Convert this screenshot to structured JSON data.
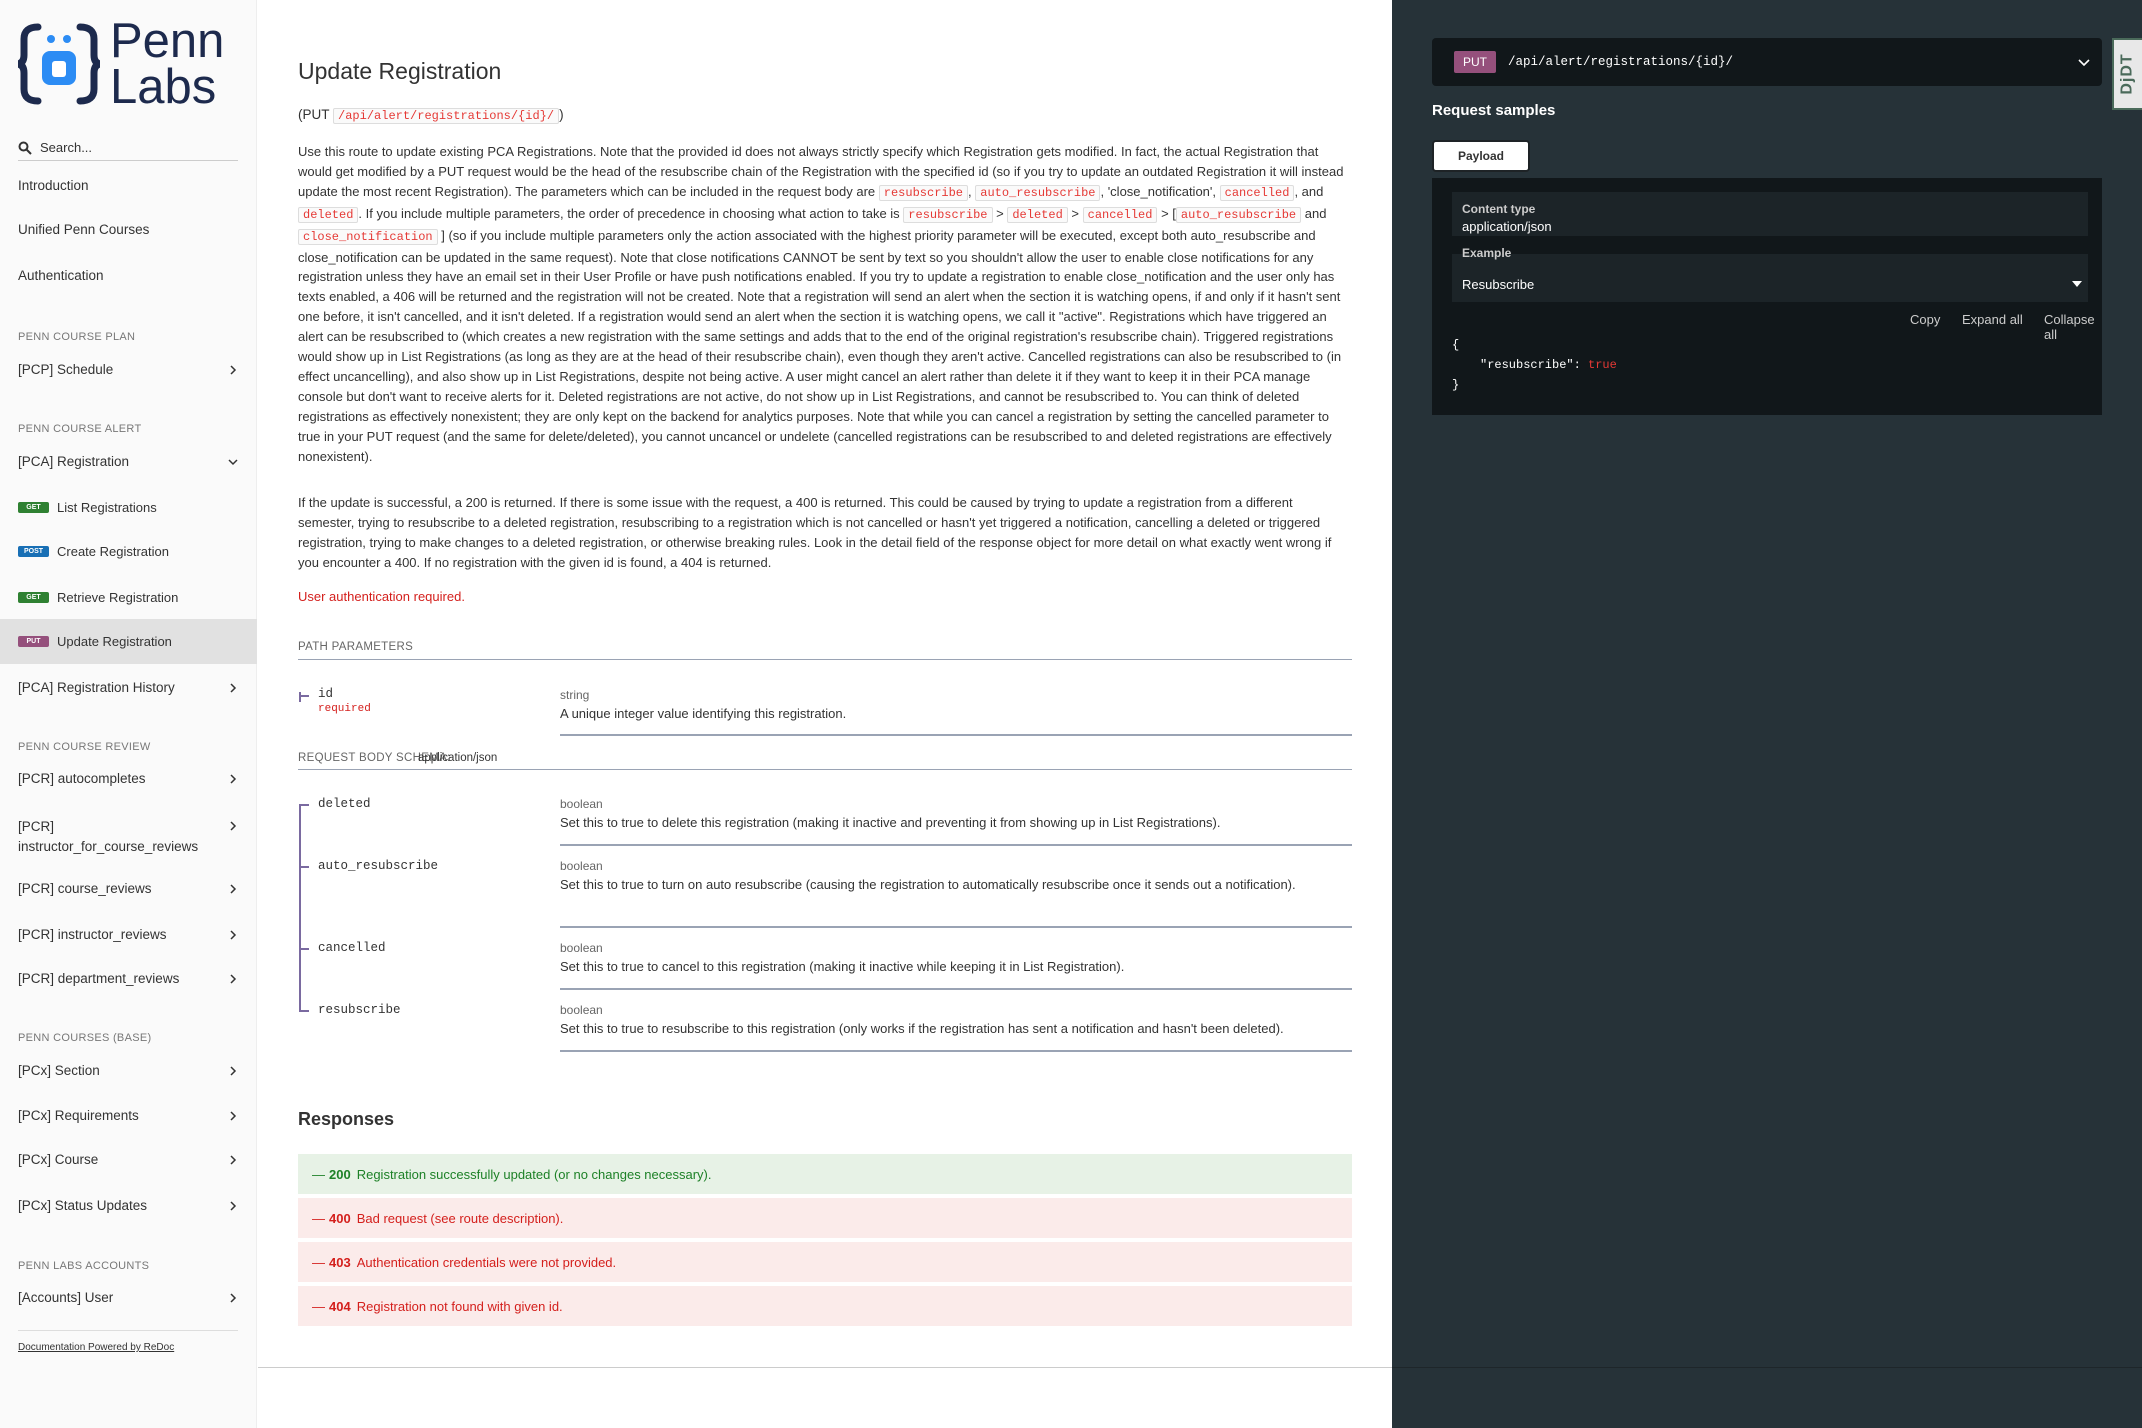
{
  "sidebar": {
    "logo_text_line1": "Penn",
    "logo_text_line2": "Labs",
    "search_placeholder": "Search...",
    "top_items": [
      "Introduction",
      "Unified Penn Courses",
      "Authentication"
    ],
    "sections": {
      "pcp": "PENN COURSE PLAN",
      "pca": "PENN COURSE ALERT",
      "pcr": "PENN COURSE REVIEW",
      "pcx": "PENN COURSES (BASE)",
      "accounts": "PENN LABS ACCOUNTS"
    },
    "pcp_items": [
      "[PCP] Schedule"
    ],
    "pca_group": "[PCA] Registration",
    "pca_subitems": [
      {
        "method": "GET",
        "label": "List Registrations"
      },
      {
        "method": "POST",
        "label": "Create Registration"
      },
      {
        "method": "GET",
        "label": "Retrieve Registration"
      },
      {
        "method": "PUT",
        "label": "Update Registration"
      }
    ],
    "pca_history": "[PCA] Registration History",
    "pcr_items": [
      "[PCR] autocompletes",
      "[PCR]",
      "instructor_for_course_reviews",
      "[PCR] course_reviews",
      "[PCR] instructor_reviews",
      "[PCR] department_reviews"
    ],
    "pcx_items": [
      "[PCx] Section",
      "[PCx] Requirements",
      "[PCx] Course",
      "[PCx] Status Updates"
    ],
    "accounts_items": [
      "[Accounts] User"
    ],
    "powered_by": "Documentation Powered by ReDoc"
  },
  "main": {
    "title": "Update Registration",
    "route_method": "PUT",
    "route_path": "/api/alert/registrations/{id}/",
    "desc_p1": {
      "a": "Use this route to update existing PCA Registrations. Note that the provided id does not always strictly specify which Registration gets modified. In fact, the actual Registration that would get modified by a PUT request would be the head of the resubscribe chain of the Registration with the specified id (so if you try to update an outdated Registration it will instead update the most recent Registration). The parameters which can be included in the request body are",
      "t1": "resubscribe",
      "b": ",",
      "t2": "auto_resubscribe",
      "c": ", 'close_notification',",
      "t3": "cancelled",
      "d": ", and",
      "t4": "deleted",
      "e": ". If you include multiple parameters, the order of precedence in choosing what action to take is",
      "t5": "resubscribe",
      "f": ">",
      "t6": "deleted",
      "g": ">",
      "t7": "cancelled",
      "h": "> [",
      "t8": "auto_resubscribe",
      "i": "and",
      "t9": "close_notification",
      "j": "] (so if you include multiple parameters only the action associated with the highest priority parameter will be executed, except both auto_resubscribe and close_notification can be updated in the same request). Note that close notifications CANNOT be sent by text so you shouldn't allow the user to enable close notifications for any registration unless they have an email set in their User Profile or have push notifications enabled. If you try to update a registration to enable close_notification and the user only has texts enabled, a 406 will be returned and the registration will not be created. Note that a registration will send an alert when the section it is watching opens, if and only if it hasn't sent one before, it isn't cancelled, and it isn't deleted. If a registration would send an alert when the section it is watching opens, we call it \"active\". Registrations which have triggered an alert can be resubscribed to (which creates a new registration with the same settings and adds that to the end of the original registration's resubscribe chain). Triggered registrations would show up in List Registrations (as long as they are at the head of their resubscribe chain), even though they aren't active. Cancelled registrations can also be resubscribed to (in effect uncancelling), and also show up in List Registrations, despite not being active. A user might cancel an alert rather than delete it if they want to keep it in their PCA manage console but don't want to receive alerts for it. Deleted registrations are not active, do not show up in List Registrations, and cannot be resubscribed to. You can think of deleted registrations as effectively nonexistent; they are only kept on the backend for analytics purposes. Note that while you can cancel a registration by setting the cancelled parameter to true in your PUT request (and the same for delete/deleted), you cannot uncancel or undelete (cancelled registrations can be resubscribed to and deleted registrations are effectively nonexistent)."
    },
    "desc_p2": "If the update is successful, a 200 is returned. If there is some issue with the request, a 400 is returned. This could be caused by trying to update a registration from a different semester, trying to resubscribe to a deleted registration, resubscribing to a registration which is not cancelled or hasn't yet triggered a notification, cancelling a deleted or triggered registration, trying to make changes to a deleted registration, or otherwise breaking rules. Look in the detail field of the response object for more detail on what exactly went wrong if you encounter a 400. If no registration with the given id is found, a 404 is returned.",
    "auth_required": "User authentication required.",
    "path_params_label": "PATH PARAMETERS",
    "path_param": {
      "name": "id",
      "required": "required",
      "type": "string",
      "desc": "A unique integer value identifying this registration."
    },
    "body_schema_label": "REQUEST BODY SCHEMA:",
    "body_schema_type": "application/json",
    "body_params": [
      {
        "name": "deleted",
        "type": "boolean",
        "desc": "Set this to true to delete this registration (making it inactive and preventing it from showing up in List Registrations)."
      },
      {
        "name": "auto_resubscribe",
        "type": "boolean",
        "desc": "Set this to true to turn on auto resubscribe (causing the registration to automatically resubscribe once it sends out a notification)."
      },
      {
        "name": "cancelled",
        "type": "boolean",
        "desc": "Set this to true to cancel to this registration (making it inactive while keeping it in List Registration)."
      },
      {
        "name": "resubscribe",
        "type": "boolean",
        "desc": "Set this to true to resubscribe to this registration (only works if the registration has sent a notification and hasn't been deleted)."
      }
    ],
    "responses_title": "Responses",
    "responses": [
      {
        "code": "200",
        "desc": "Registration successfully updated (or no changes necessary)."
      },
      {
        "code": "400",
        "desc": "Bad request (see route description)."
      },
      {
        "code": "403",
        "desc": "Authentication credentials were not provided."
      },
      {
        "code": "404",
        "desc": "Registration not found with given id."
      }
    ],
    "dash": "—"
  },
  "right": {
    "method": "PUT",
    "path": "/api/alert/registrations/{id}/",
    "samples_title": "Request samples",
    "tab_payload": "Payload",
    "content_type_label": "Content type",
    "content_type_value": "application/json",
    "example_label": "Example",
    "example_value": "Resubscribe",
    "copy": "Copy",
    "expand_all": "Expand all",
    "collapse_all": "Collapse all",
    "json_open": "{",
    "json_key": "\"resubscribe\"",
    "json_colon": ":",
    "json_value": "true",
    "json_close": "}"
  },
  "djdt": "DjDT",
  "colors": {
    "get": "#2f8132",
    "post": "#186fb5",
    "put": "#95507c",
    "error": "#d41f1c",
    "success": "#1d8127",
    "right_panel": "#263238"
  }
}
